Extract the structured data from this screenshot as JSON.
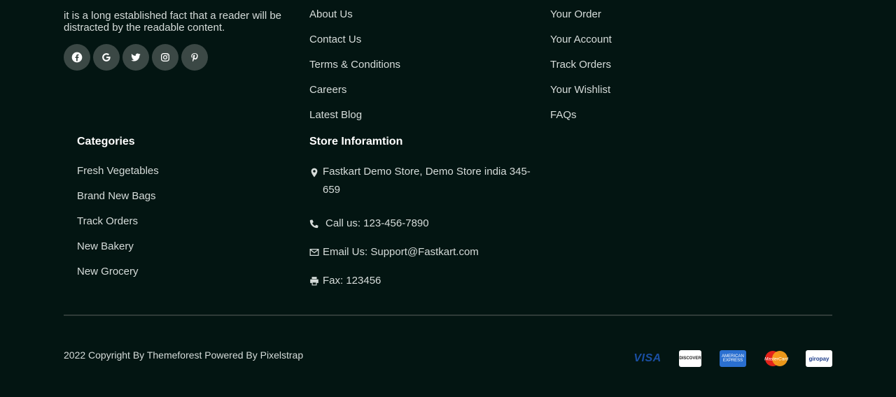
{
  "about": {
    "text": "it is a long established fact that a reader will be distracted by the readable content."
  },
  "social": [
    {
      "icon": "facebook-icon"
    },
    {
      "icon": "google-icon"
    },
    {
      "icon": "twitter-icon"
    },
    {
      "icon": "instagram-icon"
    },
    {
      "icon": "pinterest-icon"
    }
  ],
  "about_links": [
    "About Us",
    "Contact Us",
    "Terms & Conditions",
    "Careers",
    "Latest Blog"
  ],
  "account_links": [
    "Your Order",
    "Your Account",
    "Track Orders",
    "Your Wishlist",
    "FAQs"
  ],
  "categories": {
    "heading": "Categories",
    "items": [
      "Fresh Vegetables",
      "Brand New Bags",
      "Track Orders",
      "New Bakery",
      "New Grocery"
    ]
  },
  "store": {
    "heading": "Store Inforamtion",
    "address": "Fastkart Demo Store, Demo Store india 345-659",
    "call": "Call us: 123-456-7890",
    "email": "Email Us: Support@Fastkart.com",
    "fax": "Fax: 123456"
  },
  "footer": {
    "copyright": "2022 Copyright By Themeforest Powered By Pixelstrap"
  },
  "payments": {
    "visa": "VISA",
    "discover": "DISCOVER",
    "amex": "AMERICAN EXPRESS",
    "mastercard": "MasterCard",
    "giropay": "giropay"
  },
  "colors": {
    "background": "#031512",
    "social_bg": "#3b4845",
    "divider": "#2f3b38"
  }
}
